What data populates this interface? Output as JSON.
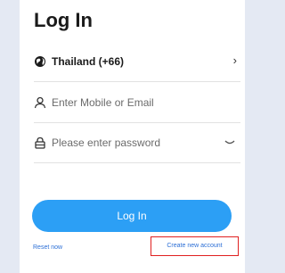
{
  "form": {
    "title": "Log In",
    "country": "Thailand (+66)",
    "user_placeholder": "Enter Mobile or Email",
    "password_placeholder": "Please enter password",
    "login_label": "Log In",
    "reset_label": "Reset now",
    "create_label": "Create new account"
  },
  "icons": {
    "country": "globe-icon",
    "country_chevron": "chevron-right-icon",
    "user": "user-icon",
    "password": "lock-icon",
    "password_toggle": "eye-closed-icon"
  },
  "colors": {
    "background": "#e4e9f3",
    "primary_button": "#2c9ff5",
    "link": "#2c6fd6",
    "highlight_border": "#e02020"
  }
}
